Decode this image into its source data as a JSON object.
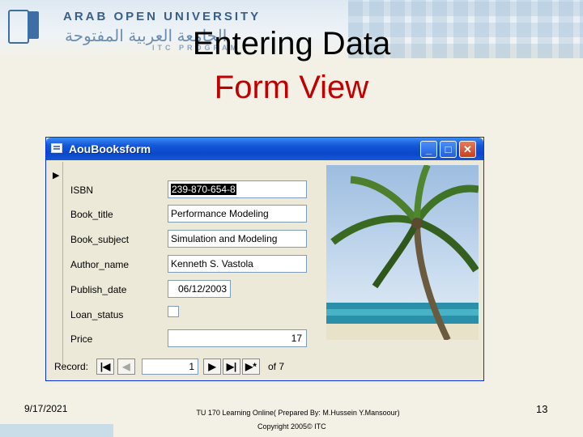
{
  "banner": {
    "university": "ARAB OPEN UNIVERSITY",
    "university_arabic": "الجامعة العربية المفتوحة",
    "program": "ITC PROGRAM"
  },
  "slide": {
    "title": "Entering Data",
    "subtitle": "Form View"
  },
  "window": {
    "title": "AouBooksform",
    "fields": [
      {
        "label": "ISBN",
        "value": "239-870-654-8"
      },
      {
        "label": "Book_title",
        "value": "Performance Modeling"
      },
      {
        "label": "Book_subject",
        "value": "Simulation and Modeling"
      },
      {
        "label": "Author_name",
        "value": "Kenneth S. Vastola"
      },
      {
        "label": "Publish_date",
        "value": "06/12/2003"
      },
      {
        "label": "Loan_status",
        "value": ""
      },
      {
        "label": "Price",
        "value": "17"
      }
    ],
    "navigator": {
      "label": "Record:",
      "current": "1",
      "of_text": "of 7"
    }
  },
  "footer": {
    "date": "9/17/2021",
    "course": "TU 170 Learning Online( Prepared By: M.Hussein Y.Mansoour)",
    "copyright": "Copyright 2005© ITC",
    "page": "13"
  },
  "colors": {
    "title_red": "#c00000",
    "titlebar_blue": "#0a47cc"
  }
}
